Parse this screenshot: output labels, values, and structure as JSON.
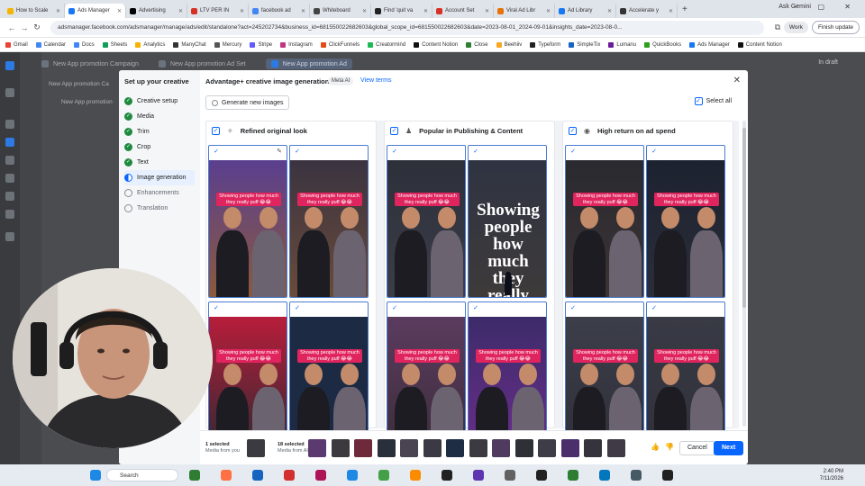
{
  "browser": {
    "tabs": [
      {
        "title": "How to Scale",
        "color": "#f4b400"
      },
      {
        "title": "Ads Manager",
        "color": "#1877f2",
        "active": true
      },
      {
        "title": "Advertising",
        "color": "#000000"
      },
      {
        "title": "LTV PER IN",
        "color": "#d93025"
      },
      {
        "title": "facebook ad",
        "color": "#4285f4"
      },
      {
        "title": "Whiteboard",
        "color": "#444444"
      },
      {
        "title": "Find 'quit va",
        "color": "#222222"
      },
      {
        "title": "Account Set",
        "color": "#d93025"
      },
      {
        "title": "Viral Ad Libr",
        "color": "#e8710a"
      },
      {
        "title": "Ad Library",
        "color": "#1877f2"
      },
      {
        "title": "Accelerate y",
        "color": "#333333"
      }
    ],
    "new_tab": "+",
    "ask_gemini": "Ask Gemini",
    "window_controls": "– ▢ ✕",
    "url": "adsmanager.facebook.com/adsmanager/manage/ads/edit/standalone?act=245202734&business_id=681550022682603&global_scope_id=681550022682603&date=2023-08-01_2024-09-01&insights_date=2023-08-0...",
    "profile": "Work",
    "finish_update": "Finish update",
    "bookmarks": [
      {
        "label": "Gmail",
        "color": "#ea4335"
      },
      {
        "label": "Calendar",
        "color": "#4285f4"
      },
      {
        "label": "Docs",
        "color": "#4285f4"
      },
      {
        "label": "Sheets",
        "color": "#0f9d58"
      },
      {
        "label": "Analytics",
        "color": "#f4b400"
      },
      {
        "label": "ManyChat",
        "color": "#333333"
      },
      {
        "label": "Mercury",
        "color": "#555555"
      },
      {
        "label": "Stripe",
        "color": "#635bff"
      },
      {
        "label": "Instagram",
        "color": "#c13584"
      },
      {
        "label": "ClickFunnels",
        "color": "#e64a19"
      },
      {
        "label": "Creatormind",
        "color": "#1db954"
      },
      {
        "label": "Content Notion",
        "color": "#111111"
      },
      {
        "label": "Close",
        "color": "#2e7d32"
      },
      {
        "label": "Beehiiv",
        "color": "#f9a825"
      },
      {
        "label": "Typeform",
        "color": "#222222"
      },
      {
        "label": "SimpleTix",
        "color": "#1565c0"
      },
      {
        "label": "Lumanu",
        "color": "#6a1b9a"
      },
      {
        "label": "QuickBooks",
        "color": "#2ca01c"
      },
      {
        "label": "Ads Manager",
        "color": "#1877f2"
      },
      {
        "label": "Content Notion",
        "color": "#111111"
      }
    ]
  },
  "breadcrumbs": {
    "campaign": "New App promotion Campaign",
    "adset": "New App promotion Ad Set",
    "ad": "New App promotion Ad",
    "status": "In draft"
  },
  "tree": [
    "New App promotion Ca",
    "New App promotion"
  ],
  "steps": {
    "title": "Set up your creative",
    "items": [
      {
        "label": "Creative setup",
        "state": "done"
      },
      {
        "label": "Media",
        "state": "done"
      },
      {
        "label": "Trim",
        "state": "done"
      },
      {
        "label": "Crop",
        "state": "done"
      },
      {
        "label": "Text",
        "state": "done"
      },
      {
        "label": "Image generation",
        "state": "current"
      },
      {
        "label": "Enhancements",
        "state": "todo"
      },
      {
        "label": "Translation",
        "state": "todo"
      }
    ]
  },
  "modal": {
    "title": "Advantage+ creative image generation",
    "meta_ai_badge": "Meta AI",
    "view_terms": "View terms",
    "generate_button": "Generate new images",
    "select_all": "Select all",
    "columns": [
      {
        "title": "Refined original look",
        "icon": "✧"
      },
      {
        "title": "Popular in Publishing & Content",
        "icon": "♟"
      },
      {
        "title": "High return on ad spend",
        "icon": "◉"
      }
    ],
    "caption": "Showing people how much they really puff 😂😂",
    "big_text": "Showing people how much they really puff",
    "check": "✓",
    "edit_icon": "✎"
  },
  "footer": {
    "original_count": "1 selected",
    "original_source": "Media from you",
    "ai_count": "18 selected",
    "ai_source": "Media from AI",
    "thumbs_up": "👍",
    "thumbs_down": "👎",
    "cancel": "Cancel",
    "next": "Next"
  },
  "taskbar": {
    "search": "Search",
    "time": "2:40 PM",
    "date": "7/11/2026"
  }
}
